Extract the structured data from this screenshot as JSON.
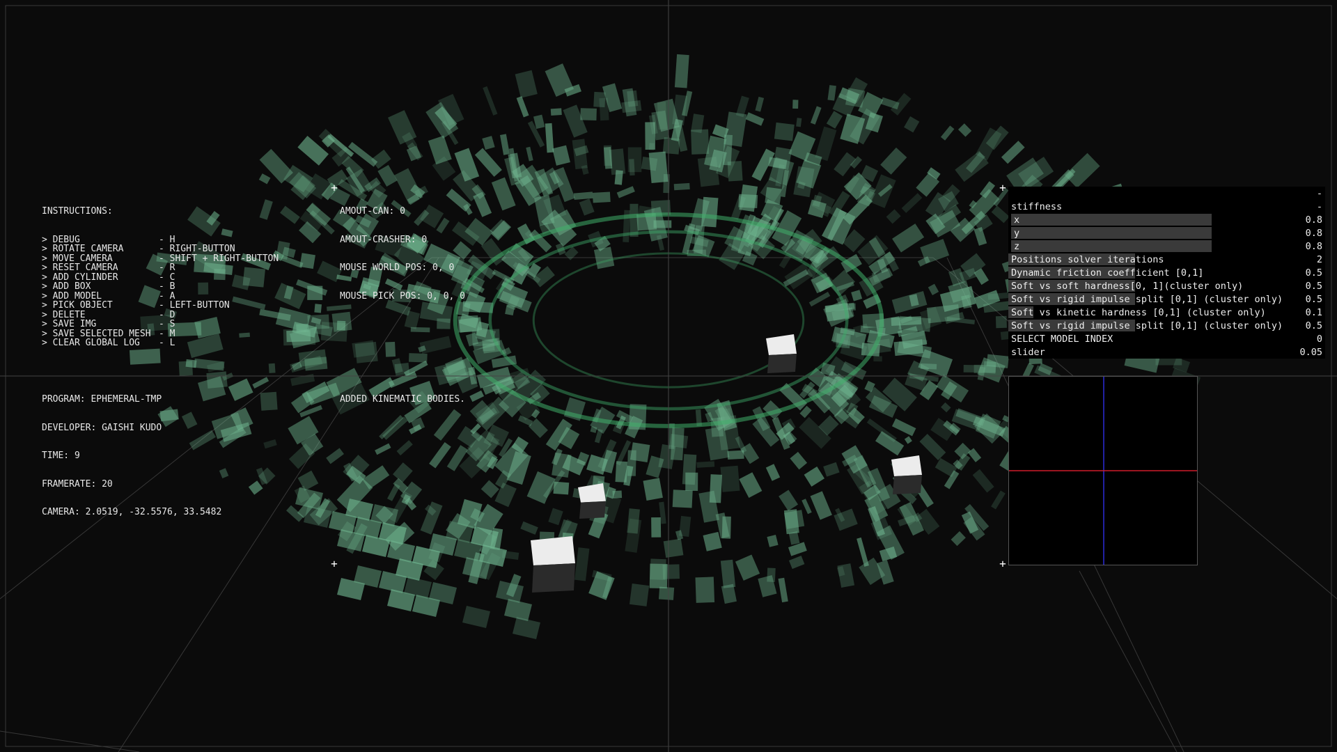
{
  "instructions": {
    "title": "INSTRUCTIONS:",
    "lines": [
      {
        "key": "> DEBUG",
        "value": "- H"
      },
      {
        "key": "> ROTATE CAMERA",
        "value": "- RIGHT-BUTTON"
      },
      {
        "key": "> MOVE CAMERA",
        "value": "- SHIFT + RIGHT-BUTTON"
      },
      {
        "key": "> RESET CAMERA",
        "value": "- R"
      },
      {
        "key": "> ADD CYLINDER",
        "value": "- C"
      },
      {
        "key": "> ADD BOX",
        "value": "- B"
      },
      {
        "key": "> ADD MODEL",
        "value": "- A"
      },
      {
        "key": "> PICK OBJECT",
        "value": "- LEFT-BUTTON"
      },
      {
        "key": "> DELETE",
        "value": "- D"
      },
      {
        "key": "> SAVE IMG",
        "value": "- S"
      },
      {
        "key": "> SAVE SELECTED MESH",
        "value": "- M"
      },
      {
        "key": "> CLEAR GLOBAL LOG",
        "value": "- L"
      }
    ]
  },
  "stats": {
    "amount_can": "AMOUT-CAN: 0",
    "amount_crasher": "AMOUT-CRASHER: 0",
    "mouse_world_pos": "MOUSE WORLD POS: 0, 0",
    "mouse_pick_pos": "MOUSE PICK POS: 0, 0, 0"
  },
  "program_info": {
    "program": "PROGRAM: EPHEMERAL-TMP",
    "developer": "DEVELOPER: GAISHI KUDO",
    "time": "TIME: 9",
    "framerate": "FRAMERATE: 20",
    "camera": "CAMERA: 2.0519, -32.5576, 33.5482"
  },
  "global_log": {
    "message": "ADDED KINEMATIC BODIES."
  },
  "gui": {
    "collapse_label": "-",
    "group_name": "stiffness",
    "group_collapse": "-",
    "rows": [
      {
        "label": "x",
        "value": "0.8",
        "fill": 0.8,
        "sub": true
      },
      {
        "label": "y",
        "value": "0.8",
        "fill": 0.8,
        "sub": true
      },
      {
        "label": "z",
        "value": "0.8",
        "fill": 0.8,
        "sub": true
      },
      {
        "label": "Positions solver iterations",
        "value": "2",
        "fill": 0.4
      },
      {
        "label": "Dynamic friction coefficient [0,1]",
        "value": "0.5",
        "fill": 0.4
      },
      {
        "label": "Soft vs soft hardness[0, 1](cluster only)",
        "value": "0.5",
        "fill": 0.4
      },
      {
        "label": "Soft vs rigid impulse split [0,1] (cluster only)",
        "value": "0.5",
        "fill": 0.4
      },
      {
        "label": "Soft vs kinetic hardness [0,1] (cluster only)",
        "value": "0.1",
        "fill": 0.08
      },
      {
        "label": "Soft vs rigid impulse split [0,1] (cluster only)",
        "value": "0.5",
        "fill": 0.4
      },
      {
        "label": "SELECT MODEL INDEX",
        "value": "0",
        "fill": 0.0
      },
      {
        "label": "slider",
        "value": "0.05",
        "fill": 0.0
      }
    ]
  },
  "colors": {
    "background": "#0b0b0b",
    "mesh_green": "#6fb58f",
    "axis_red": "#d01c2a",
    "axis_blue": "#2a2ad8",
    "slider_fill": "#3a3a3a"
  },
  "icons": [
    "crosshair-icon"
  ]
}
